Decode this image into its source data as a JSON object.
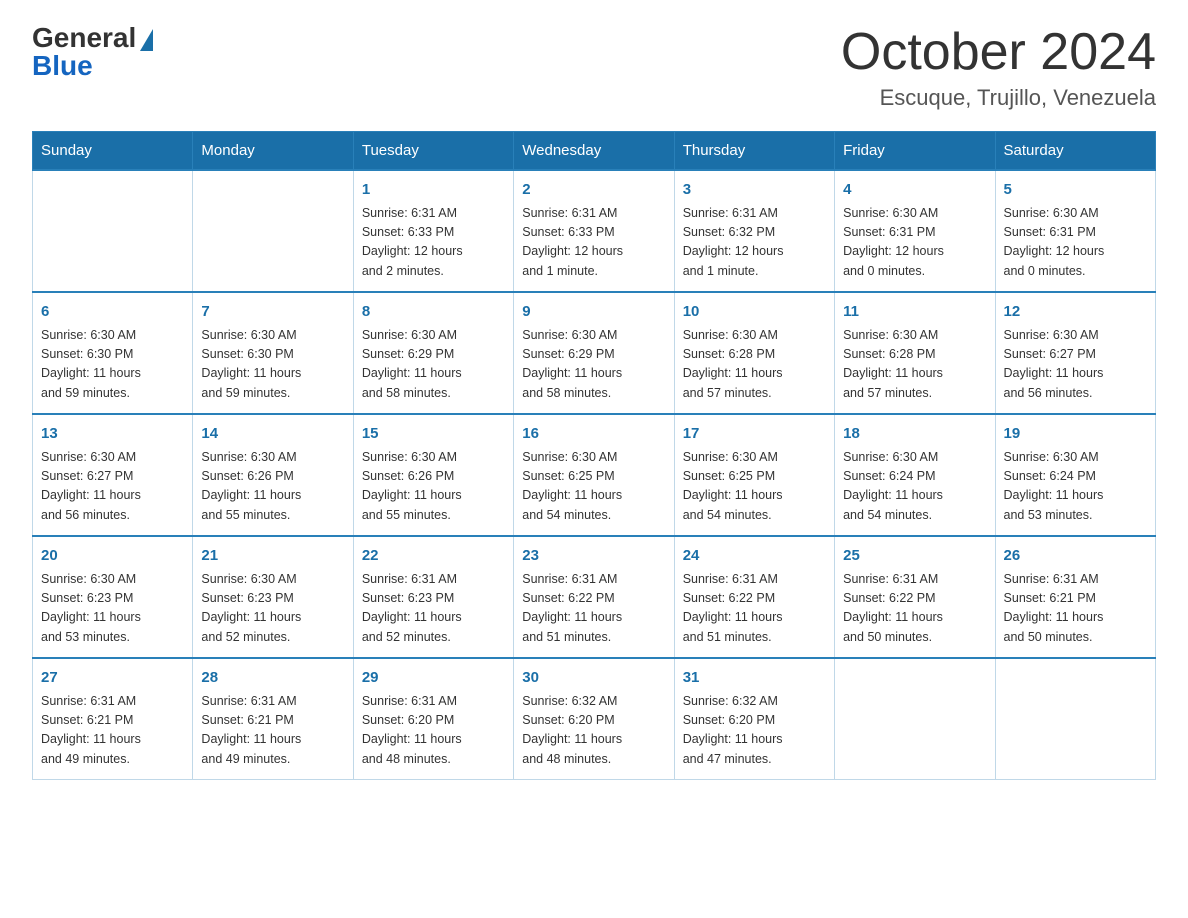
{
  "header": {
    "logo_general": "General",
    "logo_blue": "Blue",
    "month_title": "October 2024",
    "location": "Escuque, Trujillo, Venezuela"
  },
  "days_of_week": [
    "Sunday",
    "Monday",
    "Tuesday",
    "Wednesday",
    "Thursday",
    "Friday",
    "Saturday"
  ],
  "weeks": [
    [
      {
        "day": "",
        "info": ""
      },
      {
        "day": "",
        "info": ""
      },
      {
        "day": "1",
        "info": "Sunrise: 6:31 AM\nSunset: 6:33 PM\nDaylight: 12 hours\nand 2 minutes."
      },
      {
        "day": "2",
        "info": "Sunrise: 6:31 AM\nSunset: 6:33 PM\nDaylight: 12 hours\nand 1 minute."
      },
      {
        "day": "3",
        "info": "Sunrise: 6:31 AM\nSunset: 6:32 PM\nDaylight: 12 hours\nand 1 minute."
      },
      {
        "day": "4",
        "info": "Sunrise: 6:30 AM\nSunset: 6:31 PM\nDaylight: 12 hours\nand 0 minutes."
      },
      {
        "day": "5",
        "info": "Sunrise: 6:30 AM\nSunset: 6:31 PM\nDaylight: 12 hours\nand 0 minutes."
      }
    ],
    [
      {
        "day": "6",
        "info": "Sunrise: 6:30 AM\nSunset: 6:30 PM\nDaylight: 11 hours\nand 59 minutes."
      },
      {
        "day": "7",
        "info": "Sunrise: 6:30 AM\nSunset: 6:30 PM\nDaylight: 11 hours\nand 59 minutes."
      },
      {
        "day": "8",
        "info": "Sunrise: 6:30 AM\nSunset: 6:29 PM\nDaylight: 11 hours\nand 58 minutes."
      },
      {
        "day": "9",
        "info": "Sunrise: 6:30 AM\nSunset: 6:29 PM\nDaylight: 11 hours\nand 58 minutes."
      },
      {
        "day": "10",
        "info": "Sunrise: 6:30 AM\nSunset: 6:28 PM\nDaylight: 11 hours\nand 57 minutes."
      },
      {
        "day": "11",
        "info": "Sunrise: 6:30 AM\nSunset: 6:28 PM\nDaylight: 11 hours\nand 57 minutes."
      },
      {
        "day": "12",
        "info": "Sunrise: 6:30 AM\nSunset: 6:27 PM\nDaylight: 11 hours\nand 56 minutes."
      }
    ],
    [
      {
        "day": "13",
        "info": "Sunrise: 6:30 AM\nSunset: 6:27 PM\nDaylight: 11 hours\nand 56 minutes."
      },
      {
        "day": "14",
        "info": "Sunrise: 6:30 AM\nSunset: 6:26 PM\nDaylight: 11 hours\nand 55 minutes."
      },
      {
        "day": "15",
        "info": "Sunrise: 6:30 AM\nSunset: 6:26 PM\nDaylight: 11 hours\nand 55 minutes."
      },
      {
        "day": "16",
        "info": "Sunrise: 6:30 AM\nSunset: 6:25 PM\nDaylight: 11 hours\nand 54 minutes."
      },
      {
        "day": "17",
        "info": "Sunrise: 6:30 AM\nSunset: 6:25 PM\nDaylight: 11 hours\nand 54 minutes."
      },
      {
        "day": "18",
        "info": "Sunrise: 6:30 AM\nSunset: 6:24 PM\nDaylight: 11 hours\nand 54 minutes."
      },
      {
        "day": "19",
        "info": "Sunrise: 6:30 AM\nSunset: 6:24 PM\nDaylight: 11 hours\nand 53 minutes."
      }
    ],
    [
      {
        "day": "20",
        "info": "Sunrise: 6:30 AM\nSunset: 6:23 PM\nDaylight: 11 hours\nand 53 minutes."
      },
      {
        "day": "21",
        "info": "Sunrise: 6:30 AM\nSunset: 6:23 PM\nDaylight: 11 hours\nand 52 minutes."
      },
      {
        "day": "22",
        "info": "Sunrise: 6:31 AM\nSunset: 6:23 PM\nDaylight: 11 hours\nand 52 minutes."
      },
      {
        "day": "23",
        "info": "Sunrise: 6:31 AM\nSunset: 6:22 PM\nDaylight: 11 hours\nand 51 minutes."
      },
      {
        "day": "24",
        "info": "Sunrise: 6:31 AM\nSunset: 6:22 PM\nDaylight: 11 hours\nand 51 minutes."
      },
      {
        "day": "25",
        "info": "Sunrise: 6:31 AM\nSunset: 6:22 PM\nDaylight: 11 hours\nand 50 minutes."
      },
      {
        "day": "26",
        "info": "Sunrise: 6:31 AM\nSunset: 6:21 PM\nDaylight: 11 hours\nand 50 minutes."
      }
    ],
    [
      {
        "day": "27",
        "info": "Sunrise: 6:31 AM\nSunset: 6:21 PM\nDaylight: 11 hours\nand 49 minutes."
      },
      {
        "day": "28",
        "info": "Sunrise: 6:31 AM\nSunset: 6:21 PM\nDaylight: 11 hours\nand 49 minutes."
      },
      {
        "day": "29",
        "info": "Sunrise: 6:31 AM\nSunset: 6:20 PM\nDaylight: 11 hours\nand 48 minutes."
      },
      {
        "day": "30",
        "info": "Sunrise: 6:32 AM\nSunset: 6:20 PM\nDaylight: 11 hours\nand 48 minutes."
      },
      {
        "day": "31",
        "info": "Sunrise: 6:32 AM\nSunset: 6:20 PM\nDaylight: 11 hours\nand 47 minutes."
      },
      {
        "day": "",
        "info": ""
      },
      {
        "day": "",
        "info": ""
      }
    ]
  ]
}
